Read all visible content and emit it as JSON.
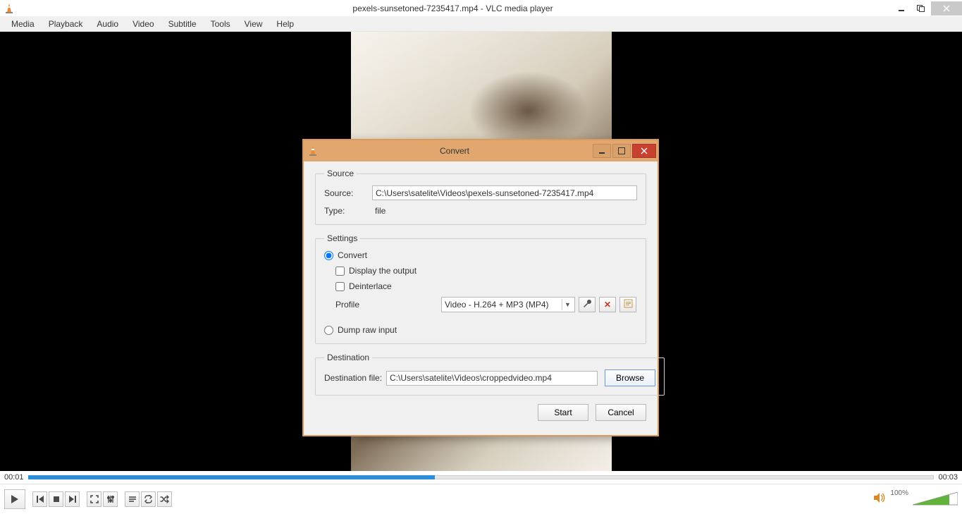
{
  "window": {
    "title": "pexels-sunsetoned-7235417.mp4 - VLC media player"
  },
  "menu": [
    "Media",
    "Playback",
    "Audio",
    "Video",
    "Subtitle",
    "Tools",
    "View",
    "Help"
  ],
  "playback": {
    "elapsed": "00:01",
    "total": "00:03",
    "progress_pct": 45
  },
  "volume": {
    "pct_label": "100%",
    "pct": 100
  },
  "dialog": {
    "title": "Convert",
    "source_group": "Source",
    "source_label": "Source:",
    "source_value": "C:\\Users\\satelite\\Videos\\pexels-sunsetoned-7235417.mp4",
    "type_label": "Type:",
    "type_value": "file",
    "settings_group": "Settings",
    "convert_label": "Convert",
    "display_output_label": "Display the output",
    "deinterlace_label": "Deinterlace",
    "profile_label": "Profile",
    "profile_value": "Video - H.264 + MP3 (MP4)",
    "dump_label": "Dump raw input",
    "destination_group": "Destination",
    "dest_label": "Destination file:",
    "dest_value": "C:\\Users\\satelite\\Videos\\croppedvideo.mp4",
    "browse": "Browse",
    "start": "Start",
    "cancel": "Cancel"
  }
}
